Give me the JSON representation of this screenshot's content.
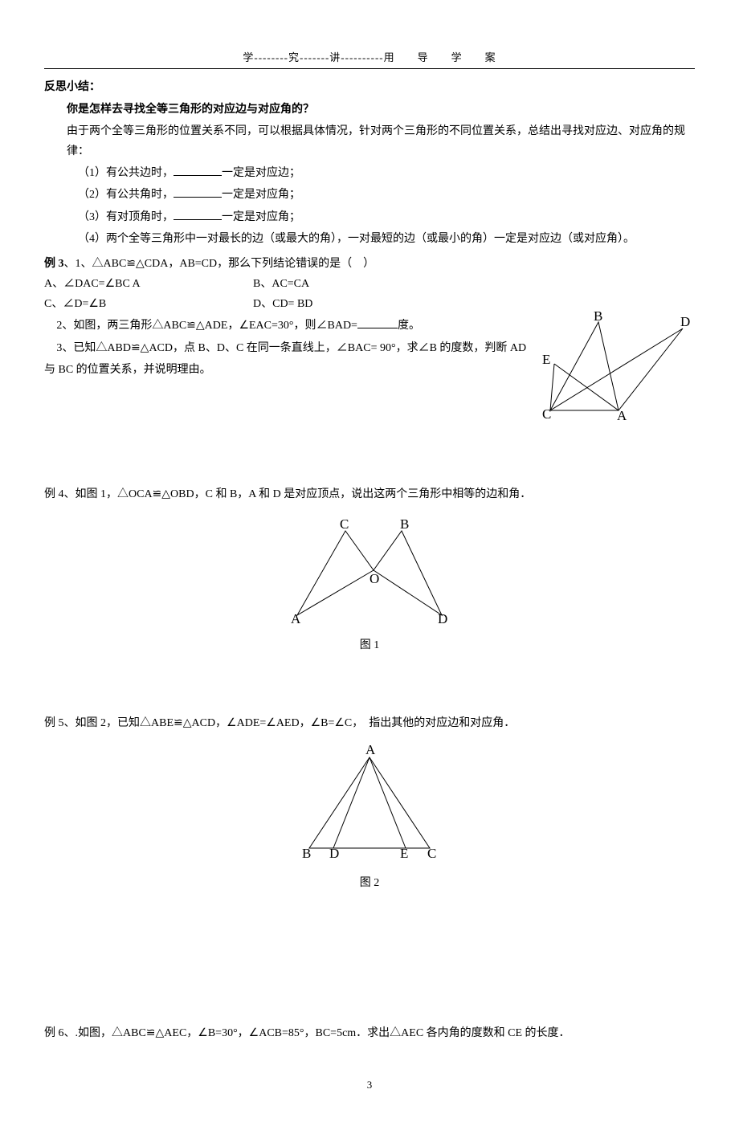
{
  "header": "学--------究-------讲----------用　　导　　学　　案",
  "reflect_title": "反思小结：",
  "q_title": "你是怎样去寻找全等三角形的对应边与对应角的？",
  "intro": "由于两个全等三角形的位置关系不同，可以根据具体情况，针对两个三角形的不同位置关系，总结出寻找对应边、对应角的规律：",
  "rule1_a": "（1）有公共边时，",
  "rule1_b": "一定是对应边；",
  "rule2_a": "（2）有公共角时，",
  "rule2_b": "一定是对应角；",
  "rule3_a": "（3）有对顶角时，",
  "rule3_b": "一定是对应角；",
  "rule4": "（4）两个全等三角形中一对最长的边（或最大的角），一对最短的边（或最小的角）一定是对应边（或对应角）。",
  "ex3_head": "例 3",
  "ex3_q1": "、1、△ABC≌△CDA，AB=CD，那么下列结论错误的是（　）",
  "ex3_optA": "A、∠DAC=∠BC A",
  "ex3_optB": "B、AC=CA",
  "ex3_optC": "C、∠D=∠B",
  "ex3_optD": "D、CD= BD",
  "ex3_q2_a": "2、如图，两三角形△ABC≌△ADE，∠EAC=30°，则∠BAD=",
  "ex3_q2_b": "度。",
  "ex3_q3_a": "3、已知△ABD≌△ACD，点 B、D、C 在同一条直线上，∠BAC= 90°，求∠B 的度数，判断 AD",
  "ex3_q3_b": "与 BC 的位置关系，并说明理由。",
  "ex4": "例 4、如图 1，△OCA≌△OBD，C 和 B，A 和 D 是对应顶点，说出这两个三角形中相等的边和角．",
  "fig1_label": "图 1",
  "ex5": "例 5、如图 2，已知△ABE≌△ACD，∠ADE=∠AED，∠B=∠C，　指出其他的对应边和对应角．",
  "fig2_label": "图 2",
  "ex6": "例 6、.如图，△ABC≌△AEC，∠B=30°，∠ACB=85°，BC=5cm．求出△AEC 各内角的度数和 CE 的长度．",
  "page_number": "3",
  "labels": {
    "A": "A",
    "B": "B",
    "C": "C",
    "D": "D",
    "E": "E",
    "O": "O"
  }
}
